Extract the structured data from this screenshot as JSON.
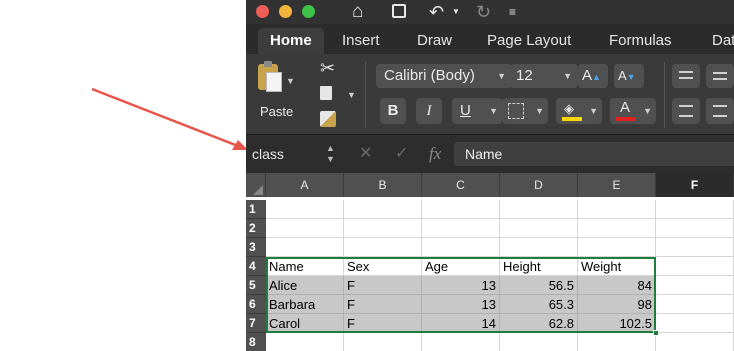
{
  "ribbon": {
    "tabs": [
      "Home",
      "Insert",
      "Draw",
      "Page Layout",
      "Formulas",
      "Dat"
    ],
    "paste_label": "Paste",
    "font_name": "Calibri (Body)",
    "font_size": "12",
    "bold": "B",
    "italic": "I",
    "underline": "U",
    "grow_font": "A",
    "shrink_font": "A",
    "font_color": "A"
  },
  "formula_bar": {
    "name_box": "class",
    "fx": "fx",
    "content": "Name"
  },
  "sheet": {
    "columns": [
      "A",
      "B",
      "C",
      "D",
      "E",
      "F"
    ],
    "rows": [
      "1",
      "2",
      "3",
      "4",
      "5",
      "6",
      "7",
      "8"
    ],
    "cells": [
      [
        "",
        "",
        "",
        "",
        "",
        ""
      ],
      [
        "",
        "",
        "",
        "",
        "",
        ""
      ],
      [
        "",
        "",
        "",
        "",
        "",
        ""
      ],
      [
        "Name",
        "Sex",
        "Age",
        "Height",
        "Weight",
        ""
      ],
      [
        "Alice",
        "F",
        "13",
        "56.5",
        "84",
        ""
      ],
      [
        "Barbara",
        "F",
        "13",
        "65.3",
        "98",
        ""
      ],
      [
        "Carol",
        "F",
        "14",
        "62.8",
        "102.5",
        ""
      ],
      [
        "",
        "",
        "",
        "",
        "",
        ""
      ]
    ]
  },
  "colors": {
    "selection_border": "#1f7d3c",
    "arrow": "#e8554a",
    "highlight_fill": "#ffd800",
    "font_color_bar": "#e02020"
  }
}
